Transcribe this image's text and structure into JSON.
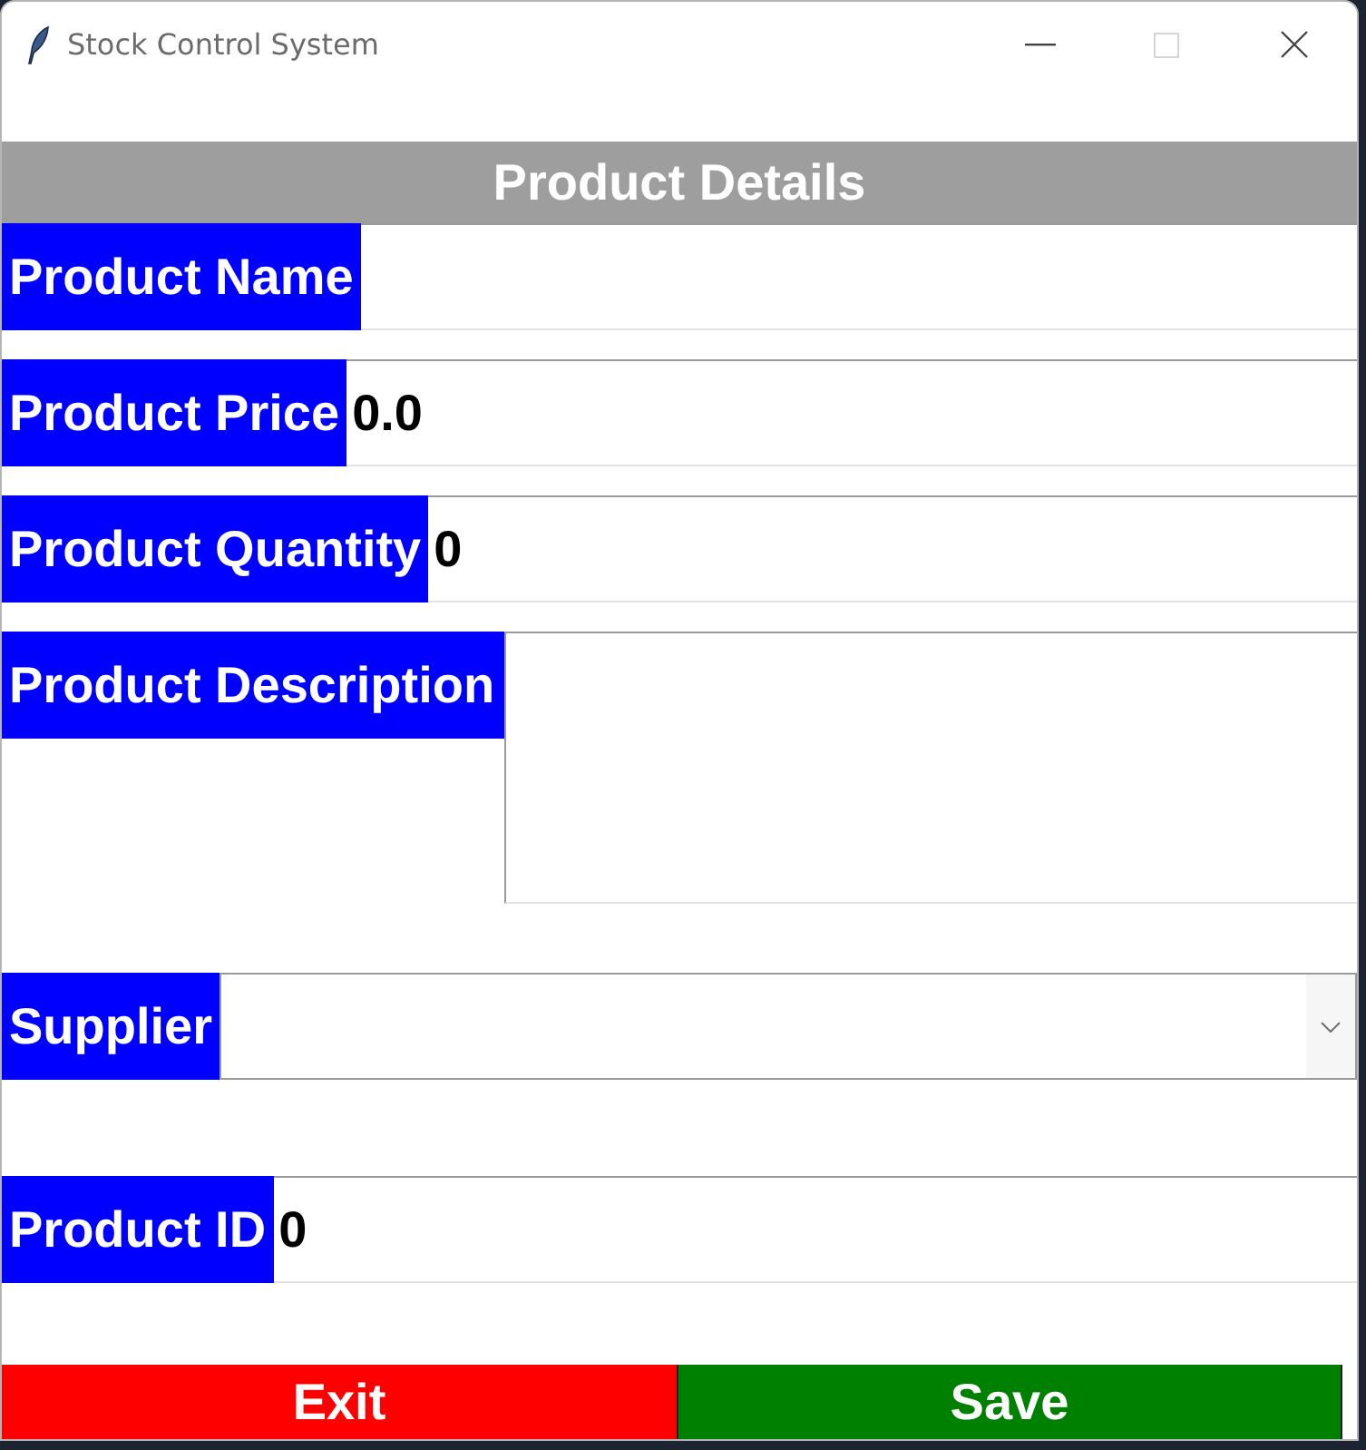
{
  "window": {
    "title": "Stock Control System",
    "controls": [
      {
        "kind": "minimize",
        "disabled": false
      },
      {
        "kind": "maximize",
        "disabled": true
      },
      {
        "kind": "close",
        "disabled": false
      }
    ]
  },
  "header": {
    "title": "Product Details"
  },
  "fields": [
    {
      "label": "Product Name",
      "kind": "entry"
    },
    {
      "label": "Product Price",
      "kind": "entry",
      "value": "0.0"
    },
    {
      "label": "Product Quantity",
      "kind": "entry",
      "value": "0"
    },
    {
      "label": "Product Description",
      "kind": "textarea"
    },
    {
      "label": "Supplier",
      "kind": "combobox"
    },
    {
      "label": "Product ID",
      "kind": "entry",
      "value": "0"
    }
  ],
  "buttons": [
    {
      "label": "Exit",
      "color": "#ff0000"
    },
    {
      "label": "Save",
      "color": "#008000"
    }
  ]
}
